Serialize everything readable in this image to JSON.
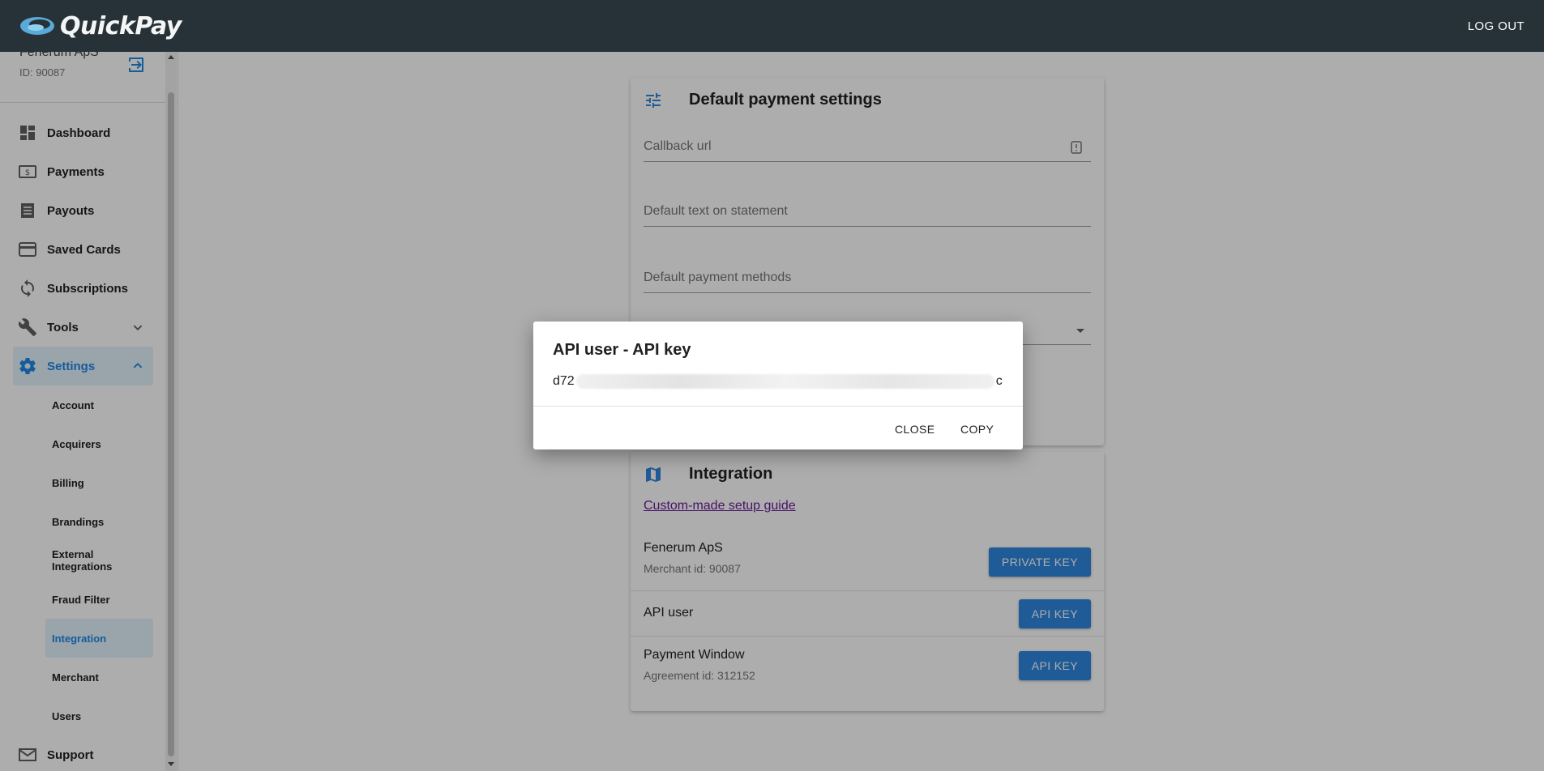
{
  "topbar": {
    "brand": "QuickPay",
    "logout": "LOG OUT"
  },
  "sidebar": {
    "account_name": "Fenerum ApS",
    "account_id": "ID: 90087",
    "items": [
      {
        "label": "Dashboard",
        "icon": "dashboard-icon"
      },
      {
        "label": "Payments",
        "icon": "payments-icon"
      },
      {
        "label": "Payouts",
        "icon": "payouts-icon"
      },
      {
        "label": "Saved Cards",
        "icon": "card-icon"
      },
      {
        "label": "Subscriptions",
        "icon": "sync-icon"
      },
      {
        "label": "Tools",
        "icon": "wrench-icon"
      },
      {
        "label": "Settings",
        "icon": "gear-icon"
      }
    ],
    "settings_items": [
      "Account",
      "Acquirers",
      "Billing",
      "Brandings",
      "External Integrations",
      "Fraud Filter",
      "Integration",
      "Merchant",
      "Users"
    ],
    "support": "Support"
  },
  "default_settings": {
    "title": "Default payment settings",
    "callback_url": "Callback url",
    "statement_text": "Default text on statement",
    "payment_methods": "Default payment methods"
  },
  "integration": {
    "title": "Integration",
    "setup_link": "Custom-made setup guide",
    "merchant_name": "Fenerum ApS",
    "merchant_id": "Merchant id: 90087",
    "private_key": "PRIVATE KEY",
    "api_user": "API user",
    "api_key_1": "API KEY",
    "payment_window": "Payment Window",
    "agreement_id": "Agreement id: 312152",
    "api_key_2": "API KEY"
  },
  "dialog": {
    "title": "API user - API key",
    "key_prefix": "d72",
    "key_suffix": "c",
    "close": "CLOSE",
    "copy": "COPY"
  },
  "colors": {
    "topbar": "#263238",
    "accent": "#2e86de",
    "active_bg": "#e3f2fd"
  }
}
